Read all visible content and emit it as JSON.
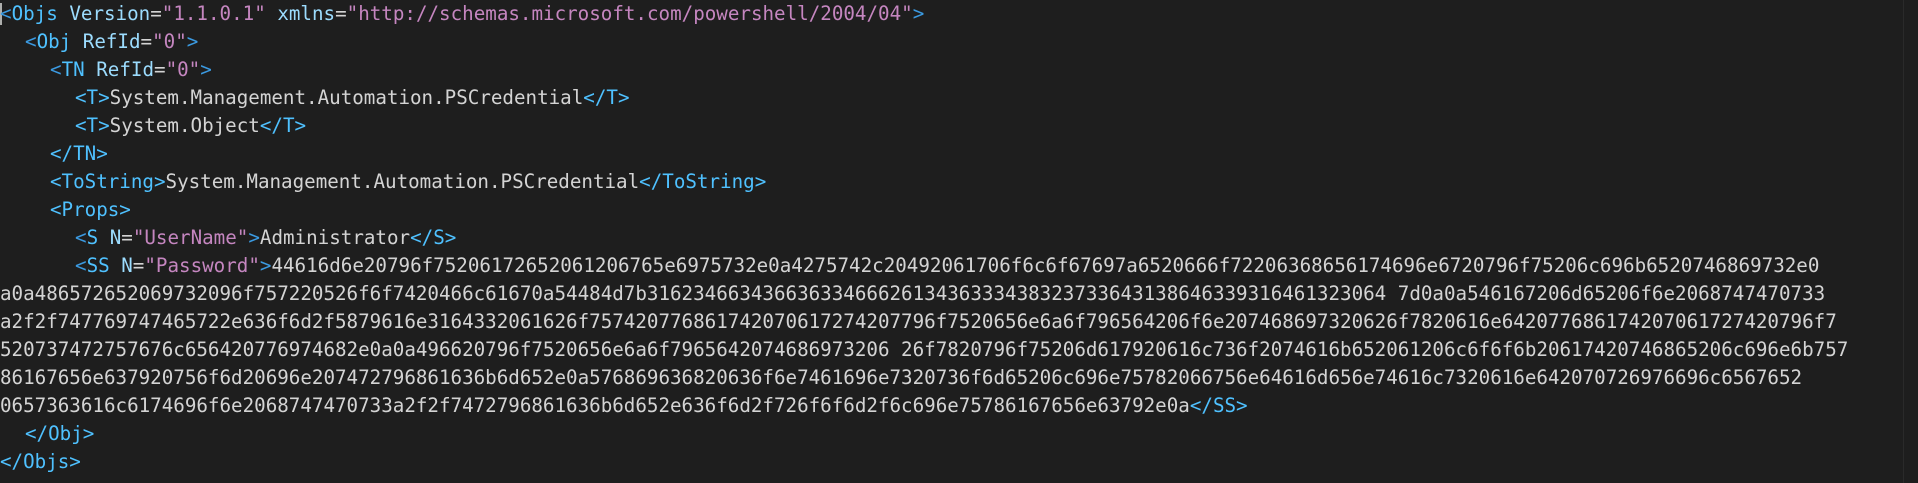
{
  "editor": {
    "lines": {
      "l1": {
        "open": "<",
        "tag": "Objs",
        "attr1": "Version",
        "eq1": "=",
        "val1": "\"1.1.0.1\"",
        "attr2": "xmlns",
        "eq2": "=",
        "val2": "\"http://schemas.microsoft.com/powershell/2004/04\"",
        "close": ">"
      },
      "l2": {
        "open": "<",
        "tag": "Obj",
        "attr": "RefId",
        "eq": "=",
        "val": "\"0\"",
        "close": ">"
      },
      "l3": {
        "open": "<",
        "tag": "TN",
        "attr": "RefId",
        "eq": "=",
        "val": "\"0\"",
        "close": ">"
      },
      "l4": {
        "open": "<T>",
        "text": "System.Management.Automation.PSCredential",
        "close": "</T>"
      },
      "l5": {
        "open": "<T>",
        "text": "System.Object",
        "close": "</T>"
      },
      "l6": {
        "tag": "</TN>"
      },
      "l7": {
        "open": "<ToString>",
        "text": "System.Management.Automation.PSCredential",
        "close": "</ToString>"
      },
      "l8": {
        "tag": "<Props>"
      },
      "l9": {
        "open": "<",
        "tag": "S",
        "attr": "N",
        "eq": "=",
        "val": "\"UserName\"",
        "gt": ">",
        "text": "Administrator",
        "close": "</S>"
      },
      "l10": {
        "open": "<",
        "tag": "SS",
        "attr": "N",
        "eq": "=",
        "val": "\"Password\"",
        "gt": ">",
        "text": "44616d6e20796f75206172652061206765e6975732e0a4275742c20492061706f6c6f67697a6520666f72206368656174696e6720796f75206c696b6520746869732e0"
      },
      "l11": {
        "text": "a0a486572652069732096f757220526f6f7420466c61670a54484d7b3162346634366363346662613436333438323733643138646339316461323064 7d0a0a546167206d65206f6e2068747470733"
      },
      "l12": {
        "text": "a2f2f747769747465722e636f6d2f5879616e3164332061626f757420776861742070617274207796f7520656e6a6f796564206f6e207468697320626f7820616e642077686174207061727420796f7"
      },
      "l13": {
        "text": "520737472757676c656420776974682e0a0a496620796f7520656e6a6f7965642074686973206 26f7820796f75206d617920616c736f2074616b652061206c6f6f6b20617420746865206c696e6b757"
      },
      "l14": {
        "text": "86167656e637920756f6d20696e207472796861636b6d652e0a576869636820636f6e7461696e7320736f6d65206c696e75782066756e64616d656e74616c7320616e642070726976696c6567652"
      },
      "l15": {
        "text": "0657363616c6174696f6e2068747470733a2f2f7472796861636b6d652e636f6d2f726f6f6d2f6c696e75786167656e63792e0a",
        "close": "</SS>"
      },
      "l16": {
        "tag": "</Obj>"
      },
      "l17": {
        "tag": "</Objs>"
      }
    }
  }
}
